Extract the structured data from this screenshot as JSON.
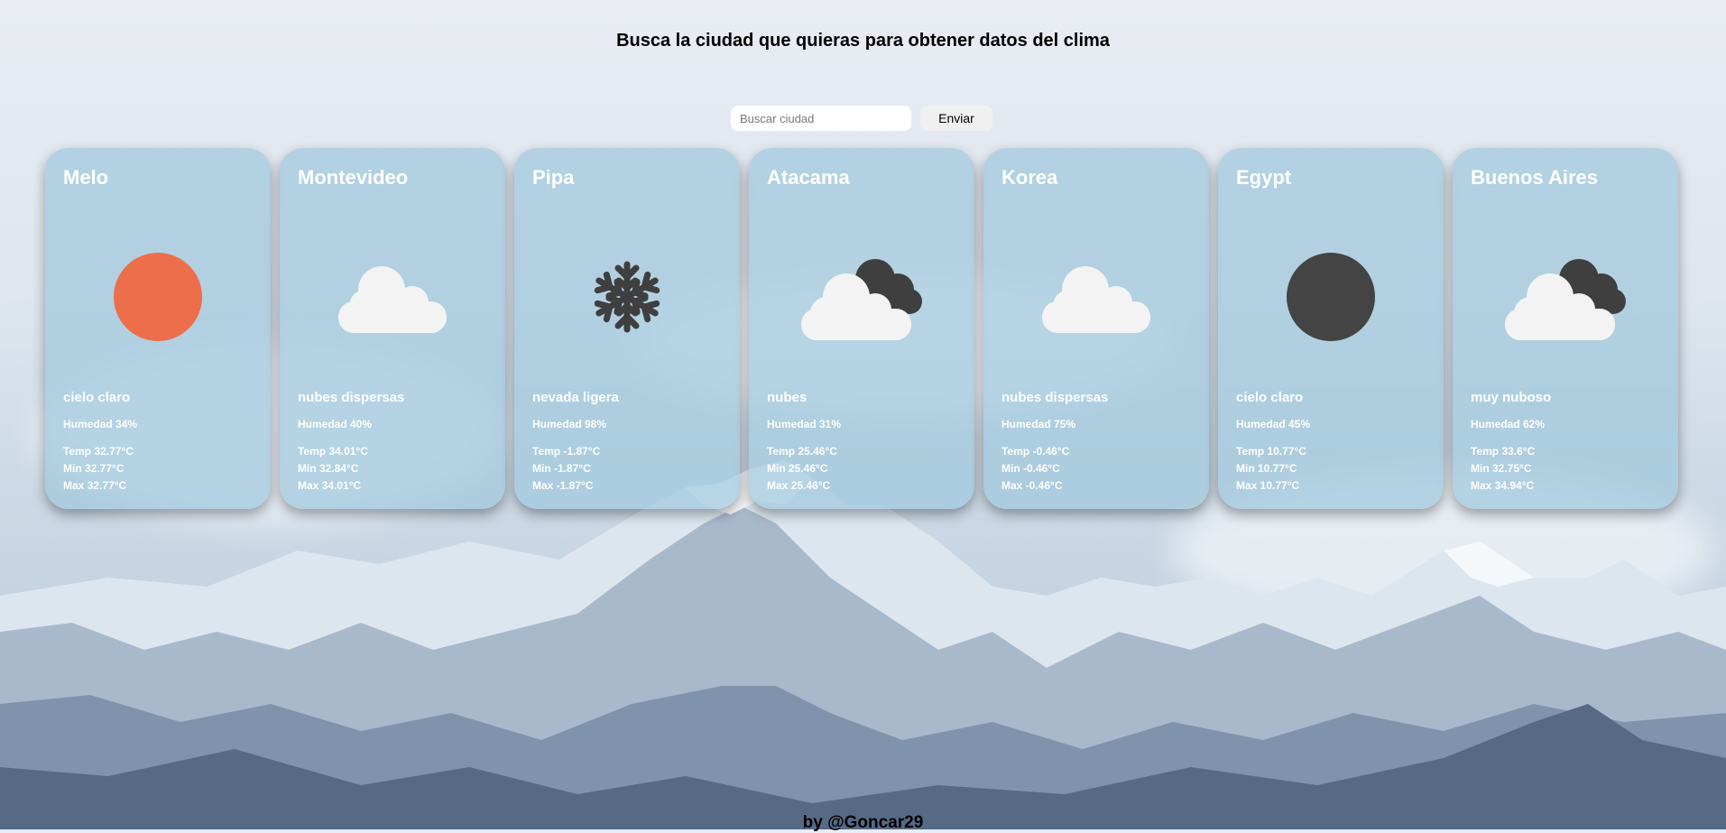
{
  "header": {
    "title": "Busca la ciudad que quieras para obtener datos del clima"
  },
  "search": {
    "placeholder": "Buscar ciudad",
    "value": "",
    "button_label": "Enviar"
  },
  "cards": [
    {
      "city": "Melo",
      "icon": "sun-icon",
      "description": "cielo claro",
      "humidity": "Humedad 34%",
      "temp": "Temp 32.77°C",
      "min": "Min 32.77°C",
      "max": "Max 32.77°C"
    },
    {
      "city": "Montevideo",
      "icon": "cloud-icon",
      "description": "nubes dispersas",
      "humidity": "Humedad 40%",
      "temp": "Temp 34.01°C",
      "min": "Min 32.84°C",
      "max": "Max 34.01°C"
    },
    {
      "city": "Pipa",
      "icon": "snowflake-icon",
      "description": "nevada ligera",
      "humidity": "Humedad 98%",
      "temp": "Temp -1.87°C",
      "min": "Min -1.87°C",
      "max": "Max -1.87°C"
    },
    {
      "city": "Atacama",
      "icon": "clouds-dark-icon",
      "description": "nubes",
      "humidity": "Humedad 31%",
      "temp": "Temp 25.46°C",
      "min": "Min 25.46°C",
      "max": "Max 25.46°C"
    },
    {
      "city": "Korea",
      "icon": "cloud-icon",
      "description": "nubes dispersas",
      "humidity": "Humedad 75%",
      "temp": "Temp -0.46°C",
      "min": "Min -0.46°C",
      "max": "Max -0.46°C"
    },
    {
      "city": "Egypt",
      "icon": "moon-icon",
      "description": "cielo claro",
      "humidity": "Humedad 45%",
      "temp": "Temp 10.77°C",
      "min": "Min 10.77°C",
      "max": "Max 10.77°C"
    },
    {
      "city": "Buenos Aires",
      "icon": "clouds-dark-icon",
      "description": "muy nuboso",
      "humidity": "Humedad 62%",
      "temp": "Temp 33.6°C",
      "min": "Min 32.75°C",
      "max": "Max 34.94°C"
    }
  ],
  "footer": {
    "credit": "by @Goncar29"
  },
  "colors": {
    "sun": "#ed6e4a",
    "moon": "#444444",
    "cloud_light": "#f3f3f3",
    "cloud_dark": "#3f3f3f",
    "card_bg": "#a0c8dc"
  }
}
